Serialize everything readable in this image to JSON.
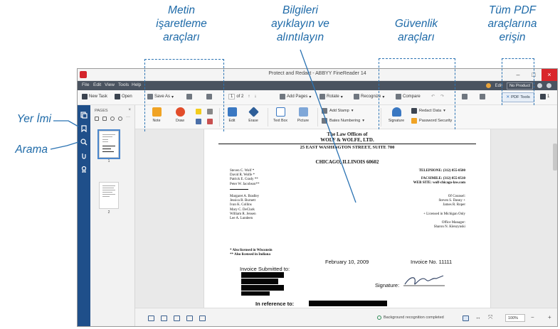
{
  "callouts": {
    "markup_tools": [
      "Metin",
      "işaretleme",
      "araçları"
    ],
    "extract": [
      "Bilgileri",
      "ayıklayın ve",
      "alıntılayın"
    ],
    "security": [
      "Güvenlik",
      "araçları"
    ],
    "all_tools": [
      "Tüm PDF",
      "araçlarına",
      "erişin"
    ],
    "bookmark": "Yer İmi",
    "search": "Arama"
  },
  "window": {
    "title": "Protect and Redact - ABBYY FineReader 14",
    "controls": [
      "–",
      "□",
      "×"
    ]
  },
  "menu": [
    "File",
    "Edit",
    "View",
    "Tools",
    "Help"
  ],
  "tray": {
    "user_icon": "coin-icon",
    "edit_label": "Edit",
    "no_product": "No Product"
  },
  "toolbar": {
    "new_task": "New Task",
    "open": "Open",
    "save_as": "Save As",
    "page_value": "1",
    "page_of": "of 2",
    "add_pages": "Add Pages",
    "rotate": "Rotate",
    "recognize": "Recognize",
    "compare": "Compare",
    "pdf_tools": "PDF Tools",
    "comments_count": "1"
  },
  "pages_panel": {
    "title": "PAGES",
    "close": "×",
    "thumb_numbers": [
      "1",
      "2"
    ]
  },
  "ribbon": {
    "note": "Note",
    "draw": "Draw",
    "edit": "Edit",
    "erase": "Erase",
    "text_box": "Text Box",
    "picture": "Picture",
    "add_stamp": "Add Stamp",
    "bates_numbering": "Bates Numbering",
    "signature": "Signature",
    "redact_data": "Redact Data",
    "password_security": "Password Security"
  },
  "document": {
    "heading1": "The Law Offices of",
    "heading2": "WOLF & WOLFE, LTD.",
    "address": "25 EAST WASHINGTON STREET, SUITE 700",
    "city": "CHICAGO, ILLINOIS 60602",
    "left_names": [
      "Steven C. Wolf *",
      "David R. Wolfe *",
      "Patrick E. Grady **",
      "Peter W. Jacobson**"
    ],
    "contacts": [
      "TELEPHONE: (312) 855-0500",
      "FACSIMILE: (312) 855-0510",
      "WEB SITE: wolf-chicago-law.com"
    ],
    "left_names2": [
      "Margaret A. Bradley",
      "Jessica R. Burnett",
      "Ivan K. Collins",
      "Mary C. DeClark",
      "William R. Jensen",
      "Lee A. Lundeen"
    ],
    "of_counsel_label": "Of Counsel:",
    "of_counsel": [
      "Steven S. Danny +",
      "James R. Roper"
    ],
    "michigan_note": "+ Licensed in Michigan Only",
    "office_manager_label": "Office Manager:",
    "office_manager": "Sharon N. Klenzynski",
    "footnotes": [
      "* Also licensed in Wisconsin",
      "** Also licensed in Indiana"
    ],
    "date": "February 10, 2009",
    "invoice_no": "Invoice No. 11111",
    "invoice_submitted": "Invoice Submitted to:",
    "signature_label": "Signature:",
    "reference": "In reference to:"
  },
  "status": {
    "text": "Background recognition completed",
    "zoom": "100%",
    "zoom_out": "−",
    "zoom_in": "+"
  },
  "colors": {
    "accent": "#1e6aa8",
    "menubar": "#4a5360",
    "sidebar": "#1f4f8a",
    "close": "#d9262b"
  }
}
